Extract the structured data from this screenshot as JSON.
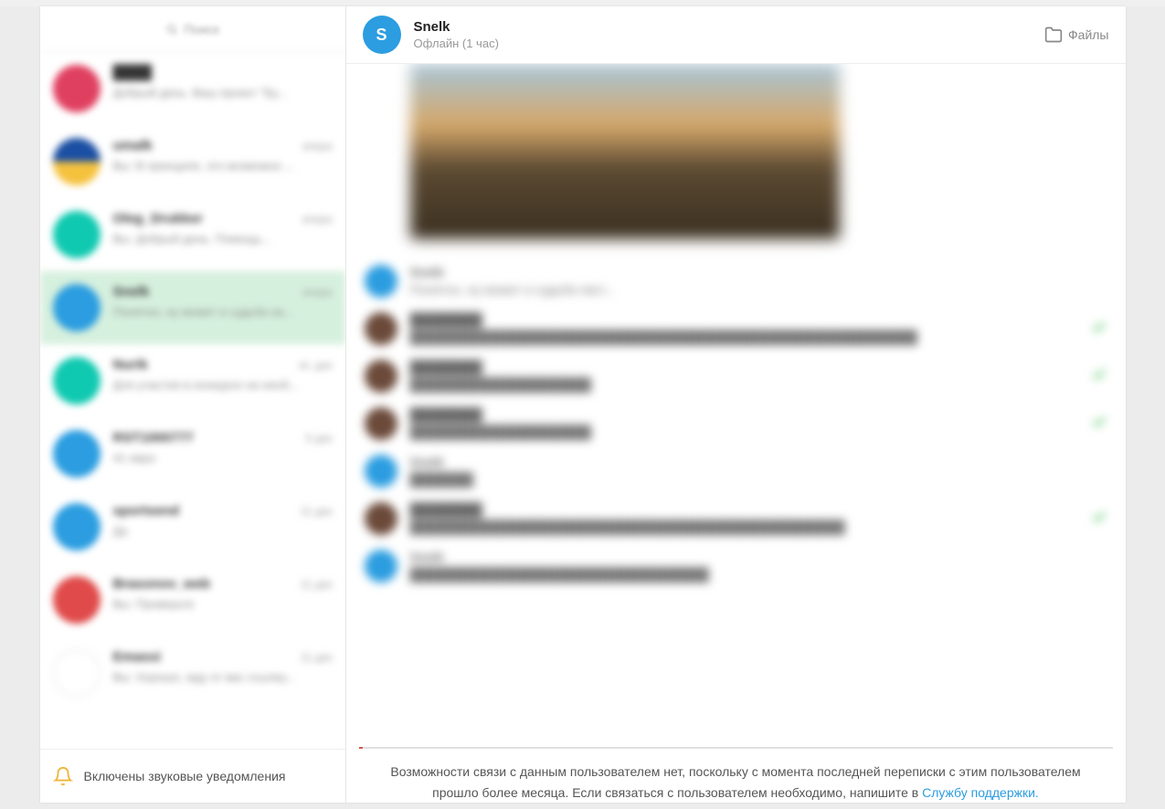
{
  "sidebar": {
    "search_placeholder": "Поиск",
    "chats": [
      {
        "name": "████",
        "time": "",
        "preview": "Добрый день. Ваш проект \"Бу...",
        "avatar": "av-pink",
        "active": false
      },
      {
        "name": "umalk",
        "time": "вчера",
        "preview": "Вы: В принципе, это возможно ...",
        "avatar": "av-flag",
        "active": false
      },
      {
        "name": "Oleg_Drukker",
        "time": "вчера",
        "preview": "Вы: Добрый день. Помощь...",
        "avatar": "av-teal",
        "active": false
      },
      {
        "name": "Snelk",
        "time": "вчера",
        "preview": "Понятно, ну может и судьба на...",
        "avatar": "av-blue",
        "active": true
      },
      {
        "name": "Nurik",
        "time": "вт, дек",
        "preview": "Для участия в конкурсе на необ...",
        "avatar": "av-teal",
        "active": false
      },
      {
        "name": "RST1000777",
        "time": "5 дек",
        "preview": "41 евро",
        "avatar": "av-blue",
        "active": false
      },
      {
        "name": "sportsend",
        "time": "11 дек",
        "preview": "Да",
        "avatar": "av-blue",
        "active": false
      },
      {
        "name": "Brasonov_web",
        "time": "11 дек",
        "preview": "Вы: Проверьте",
        "avatar": "av-red",
        "active": false
      },
      {
        "name": "Emassi",
        "time": "11 дек",
        "preview": "Вы: Хорошо, жду от вас ссылку...",
        "avatar": "av-white",
        "active": false
      }
    ],
    "footer_text": "Включены звуковые уведомления"
  },
  "header": {
    "avatar_letter": "S",
    "name": "Snelk",
    "status": "Офлайн (1 час)",
    "files_label": "Файлы"
  },
  "messages": [
    {
      "author": "Snelk",
      "time": "",
      "text": "Понятно, ну может и судьба паcт...",
      "avatar": "av-blue",
      "check": false
    },
    {
      "author": "████████",
      "time": "",
      "text": "████████████████████████████████████████████████████████",
      "avatar": "av-brown",
      "check": true
    },
    {
      "author": "████████",
      "time": "",
      "text": "████████████████████",
      "avatar": "av-brown",
      "check": true
    },
    {
      "author": "████████",
      "time": "",
      "text": "████████████████████",
      "avatar": "av-brown",
      "check": true
    },
    {
      "author": "Snelk",
      "time": "",
      "text": "███████",
      "avatar": "av-blue",
      "check": false
    },
    {
      "author": "████████",
      "time": "",
      "text": "████████████████████████████████████████████████",
      "avatar": "av-brown",
      "check": true
    },
    {
      "author": "Snelk",
      "time": "",
      "text": "█████████████████████████████████",
      "avatar": "av-blue",
      "check": false
    }
  ],
  "notice": {
    "text_before": "Возможности связи с данным пользователем нет, поскольку с момента последней переписки с этим пользователем прошло более месяца. Если связаться с пользователем необходимо, напишите в ",
    "link_text": "Службу поддержки."
  }
}
